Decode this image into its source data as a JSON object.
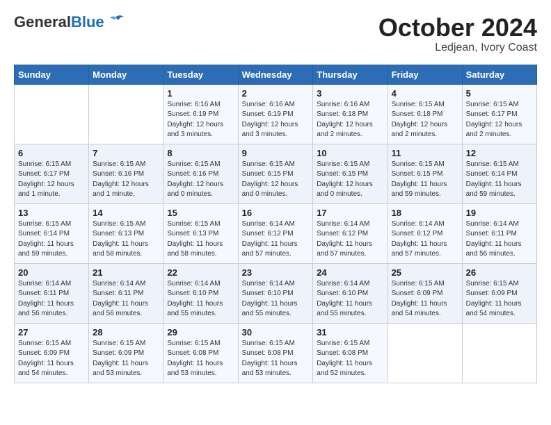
{
  "logo": {
    "general": "General",
    "blue": "Blue"
  },
  "title": "October 2024",
  "subtitle": "Ledjean, Ivory Coast",
  "headers": [
    "Sunday",
    "Monday",
    "Tuesday",
    "Wednesday",
    "Thursday",
    "Friday",
    "Saturday"
  ],
  "weeks": [
    [
      {
        "day": "",
        "info": ""
      },
      {
        "day": "",
        "info": ""
      },
      {
        "day": "1",
        "info": "Sunrise: 6:16 AM\nSunset: 6:19 PM\nDaylight: 12 hours and 3 minutes."
      },
      {
        "day": "2",
        "info": "Sunrise: 6:16 AM\nSunset: 6:19 PM\nDaylight: 12 hours and 3 minutes."
      },
      {
        "day": "3",
        "info": "Sunrise: 6:16 AM\nSunset: 6:18 PM\nDaylight: 12 hours and 2 minutes."
      },
      {
        "day": "4",
        "info": "Sunrise: 6:15 AM\nSunset: 6:18 PM\nDaylight: 12 hours and 2 minutes."
      },
      {
        "day": "5",
        "info": "Sunrise: 6:15 AM\nSunset: 6:17 PM\nDaylight: 12 hours and 2 minutes."
      }
    ],
    [
      {
        "day": "6",
        "info": "Sunrise: 6:15 AM\nSunset: 6:17 PM\nDaylight: 12 hours and 1 minute."
      },
      {
        "day": "7",
        "info": "Sunrise: 6:15 AM\nSunset: 6:16 PM\nDaylight: 12 hours and 1 minute."
      },
      {
        "day": "8",
        "info": "Sunrise: 6:15 AM\nSunset: 6:16 PM\nDaylight: 12 hours and 0 minutes."
      },
      {
        "day": "9",
        "info": "Sunrise: 6:15 AM\nSunset: 6:15 PM\nDaylight: 12 hours and 0 minutes."
      },
      {
        "day": "10",
        "info": "Sunrise: 6:15 AM\nSunset: 6:15 PM\nDaylight: 12 hours and 0 minutes."
      },
      {
        "day": "11",
        "info": "Sunrise: 6:15 AM\nSunset: 6:15 PM\nDaylight: 11 hours and 59 minutes."
      },
      {
        "day": "12",
        "info": "Sunrise: 6:15 AM\nSunset: 6:14 PM\nDaylight: 11 hours and 59 minutes."
      }
    ],
    [
      {
        "day": "13",
        "info": "Sunrise: 6:15 AM\nSunset: 6:14 PM\nDaylight: 11 hours and 59 minutes."
      },
      {
        "day": "14",
        "info": "Sunrise: 6:15 AM\nSunset: 6:13 PM\nDaylight: 11 hours and 58 minutes."
      },
      {
        "day": "15",
        "info": "Sunrise: 6:15 AM\nSunset: 6:13 PM\nDaylight: 11 hours and 58 minutes."
      },
      {
        "day": "16",
        "info": "Sunrise: 6:14 AM\nSunset: 6:12 PM\nDaylight: 11 hours and 57 minutes."
      },
      {
        "day": "17",
        "info": "Sunrise: 6:14 AM\nSunset: 6:12 PM\nDaylight: 11 hours and 57 minutes."
      },
      {
        "day": "18",
        "info": "Sunrise: 6:14 AM\nSunset: 6:12 PM\nDaylight: 11 hours and 57 minutes."
      },
      {
        "day": "19",
        "info": "Sunrise: 6:14 AM\nSunset: 6:11 PM\nDaylight: 11 hours and 56 minutes."
      }
    ],
    [
      {
        "day": "20",
        "info": "Sunrise: 6:14 AM\nSunset: 6:11 PM\nDaylight: 11 hours and 56 minutes."
      },
      {
        "day": "21",
        "info": "Sunrise: 6:14 AM\nSunset: 6:11 PM\nDaylight: 11 hours and 56 minutes."
      },
      {
        "day": "22",
        "info": "Sunrise: 6:14 AM\nSunset: 6:10 PM\nDaylight: 11 hours and 55 minutes."
      },
      {
        "day": "23",
        "info": "Sunrise: 6:14 AM\nSunset: 6:10 PM\nDaylight: 11 hours and 55 minutes."
      },
      {
        "day": "24",
        "info": "Sunrise: 6:14 AM\nSunset: 6:10 PM\nDaylight: 11 hours and 55 minutes."
      },
      {
        "day": "25",
        "info": "Sunrise: 6:15 AM\nSunset: 6:09 PM\nDaylight: 11 hours and 54 minutes."
      },
      {
        "day": "26",
        "info": "Sunrise: 6:15 AM\nSunset: 6:09 PM\nDaylight: 11 hours and 54 minutes."
      }
    ],
    [
      {
        "day": "27",
        "info": "Sunrise: 6:15 AM\nSunset: 6:09 PM\nDaylight: 11 hours and 54 minutes."
      },
      {
        "day": "28",
        "info": "Sunrise: 6:15 AM\nSunset: 6:09 PM\nDaylight: 11 hours and 53 minutes."
      },
      {
        "day": "29",
        "info": "Sunrise: 6:15 AM\nSunset: 6:08 PM\nDaylight: 11 hours and 53 minutes."
      },
      {
        "day": "30",
        "info": "Sunrise: 6:15 AM\nSunset: 6:08 PM\nDaylight: 11 hours and 53 minutes."
      },
      {
        "day": "31",
        "info": "Sunrise: 6:15 AM\nSunset: 6:08 PM\nDaylight: 11 hours and 52 minutes."
      },
      {
        "day": "",
        "info": ""
      },
      {
        "day": "",
        "info": ""
      }
    ]
  ]
}
